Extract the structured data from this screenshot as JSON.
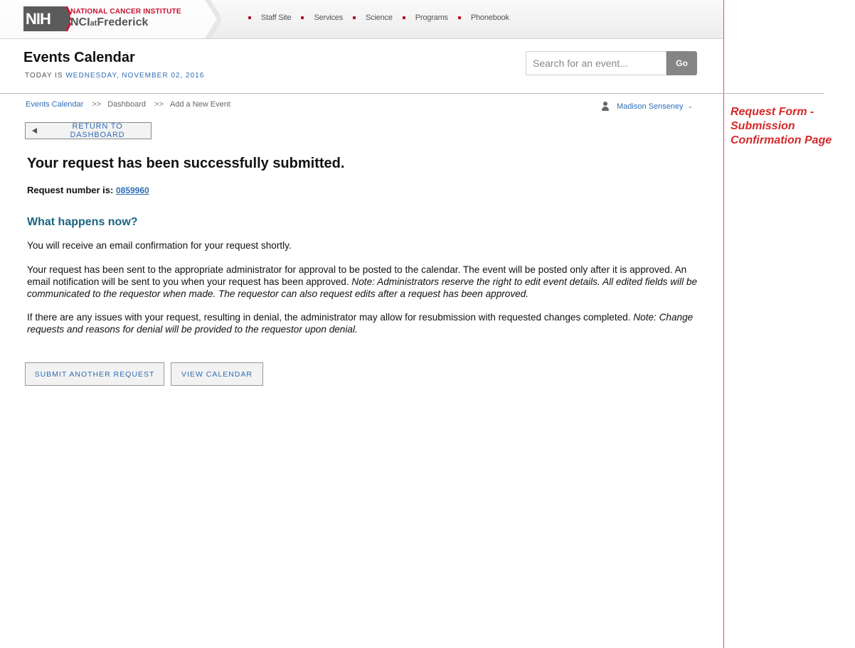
{
  "brand": {
    "logo_text": "NIH",
    "institute": "NATIONAL CANCER INSTITUTE",
    "site_prefix": "NCI",
    "site_mid": "at",
    "site_name": "Frederick",
    "accent": "#c8102e"
  },
  "nav": {
    "items": [
      {
        "label": "Staff Site"
      },
      {
        "label": "Services"
      },
      {
        "label": "Science"
      },
      {
        "label": "Programs"
      },
      {
        "label": "Phonebook"
      }
    ]
  },
  "header": {
    "title": "Events Calendar",
    "today_label": "TODAY IS ",
    "today_date": "WEDNESDAY, NOVEMBER 02, 2016",
    "search_placeholder": "Search for an event...",
    "search_value": "",
    "go_label": "Go"
  },
  "breadcrumb": {
    "items": [
      "Events Calendar",
      "Dashboard",
      "Add a New Event"
    ],
    "separator": ">>"
  },
  "user": {
    "name": "Madison Senseney",
    "icon": "user-icon",
    "dropdown_icon": "chevron-down-icon"
  },
  "return_button": {
    "label": "RETURN TO DASHBOARD",
    "icon": "triangle-left-icon"
  },
  "confirmation": {
    "heading": "Your request has been successfully submitted.",
    "request_label": "Request number is:",
    "request_number": "0859960",
    "what_heading": "What happens now?",
    "p1": "You will receive an email confirmation for your request shortly.",
    "p2_main": "Your request has been sent to the appropriate administrator for approval to be posted to the calendar. The event will be posted only after it is approved. An email notification will be sent to you when your request has been approved. ",
    "p2_note": "Note: Administrators reserve the right to edit event details. All edited fields will be communicated to the requestor when made. The requestor can also request edits after a request has been approved.",
    "p3_main": "If there are any issues with your request, resulting in denial, the administrator may allow for resubmission with requested changes completed. ",
    "p3_note": "Note: Change requests and reasons for denial will be provided to the requestor upon denial."
  },
  "actions": {
    "submit_another": "SUBMIT ANOTHER REQUEST",
    "view_calendar": "VIEW CALENDAR"
  },
  "annotation": {
    "text": "Request Form - Submission Confirmation Page",
    "color": "#d42929"
  }
}
